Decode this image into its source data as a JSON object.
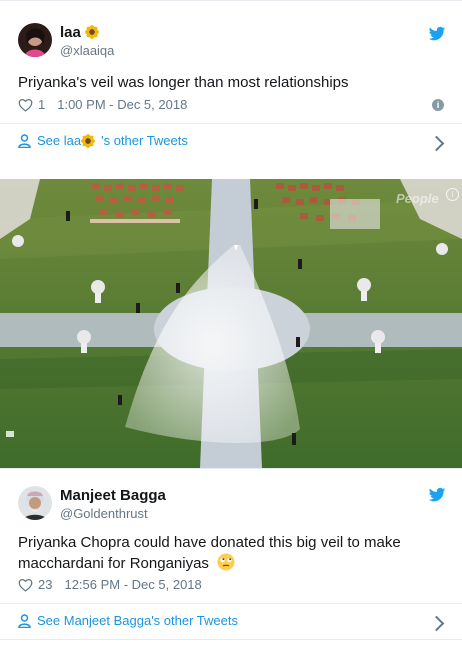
{
  "tweet1": {
    "name": "laa",
    "handle": "@xlaaiqa",
    "text": "Priyanka's veil was longer than most relationships",
    "likes": "1",
    "timestamp": "1:00 PM - Dec 5, 2018",
    "see_more": "See laa",
    "see_more_suffix": "'s other Tweets"
  },
  "photo": {
    "watermark": "People"
  },
  "tweet2": {
    "name": "Manjeet Bagga",
    "handle": "@Goldenthrust",
    "text_line1": "Priyanka Chopra could have donated this big veil to make",
    "text_line2": "macchardani for Ronganiyas",
    "likes": "23",
    "timestamp": "12:56 PM - Dec 5, 2018",
    "see_more": "See Manjeet Bagga's other Tweets"
  },
  "icons": {
    "bird": "twitter-bird-icon",
    "heart": "heart-icon",
    "info": "info-icon",
    "person": "person-icon",
    "chevron": "chevron-right-icon",
    "sunflower": "sunflower-emoji",
    "eyeroll": "eye-roll-emoji"
  },
  "colors": {
    "twitter_blue": "#1da1f2",
    "link_blue": "#1b95e0",
    "muted": "#657786",
    "divider": "#e6ecf0"
  }
}
